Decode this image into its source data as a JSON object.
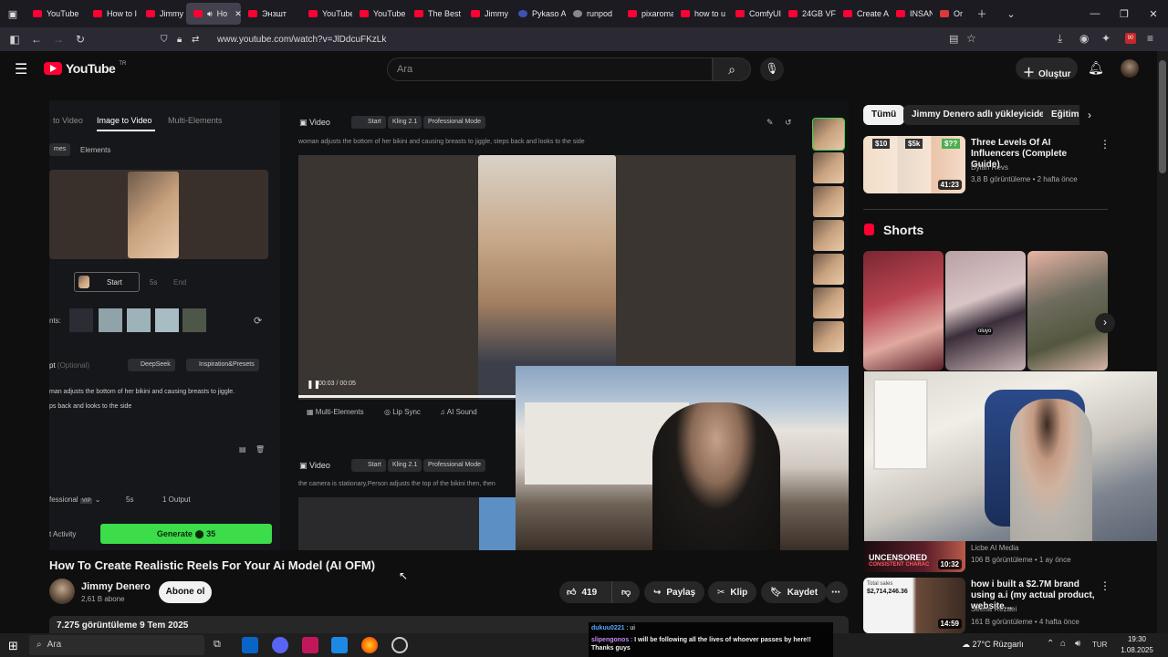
{
  "browser": {
    "tabs": [
      {
        "label": "YouTube",
        "icon": "youtube-icon"
      },
      {
        "label": "How to I",
        "icon": "youtube-icon"
      },
      {
        "label": "Jimmy D",
        "icon": "youtube-icon"
      },
      {
        "label": "Ho",
        "icon": "youtube-icon",
        "active": true
      },
      {
        "label": "Энзшт",
        "icon": "youtube-icon"
      },
      {
        "label": "YouTube",
        "icon": "youtube-icon"
      },
      {
        "label": "YouTube",
        "icon": "youtube-icon"
      },
      {
        "label": "The Best",
        "icon": "youtube-icon"
      },
      {
        "label": "Jimmy D",
        "icon": "youtube-icon"
      },
      {
        "label": "Pykaso A",
        "icon": "pykaso-icon"
      },
      {
        "label": "runpod",
        "icon": "runpod-icon"
      },
      {
        "label": "pixaroma",
        "icon": "youtube-icon"
      },
      {
        "label": "how to u",
        "icon": "youtube-icon"
      },
      {
        "label": "ComfyUI",
        "icon": "youtube-icon"
      },
      {
        "label": "24GB VF",
        "icon": "youtube-icon"
      },
      {
        "label": "Create A",
        "icon": "youtube-icon"
      },
      {
        "label": "INSANE",
        "icon": "youtube-icon"
      },
      {
        "label": "Or",
        "icon": "folder-icon"
      }
    ],
    "url": "www.youtube.com/watch?v=JlDdcuFKzLk",
    "extension_badge": "90"
  },
  "yt_header": {
    "logo": "YouTube",
    "logo_sup": "TR",
    "search_placeholder": "Ara",
    "create_label": "Oluştur"
  },
  "player": {
    "tabs": [
      "to Video",
      "Image to Video",
      "Multi-Elements"
    ],
    "subtabs": [
      "mes",
      "Elements"
    ],
    "start_label": "Start",
    "end_label": "End",
    "frame_sep": "5s",
    "elements_label": "nts:",
    "prompt_label": "pt",
    "prompt_optional": "(Optional)",
    "deepseek_label": "DeepSeek",
    "inspiration_label": "Inspiration&Presets",
    "prompt_text_1": "man adjusts the bottom of her bikini and causing breasts to jiggle.",
    "prompt_text_2": "ps back and looks to the side",
    "mode_label": "fessional",
    "vip_label": "VIP",
    "duration_label": "5s",
    "output_label": "1 Output",
    "activity_label": "t Activity",
    "generate_label": "Generate",
    "generate_cost": "35",
    "video1_label": "Video",
    "chip_start": "Start",
    "chip_kling": "Kling 2.1",
    "chip_pro": "Professional Mode",
    "video1_caption": "woman adjusts the bottom of her bikini and causing breasts to jiggle, steps back and looks to the side",
    "time_current": "00:03",
    "time_total": "00:05",
    "multi_elements": "Multi-Elements",
    "lip_sync": "Lip Sync",
    "ai_sound": "AI Sound",
    "video2_label": "Video",
    "video2_caption": "the camera is stationary,Person adjusts the top of the bikini then, then",
    "playback_progress": 0.6
  },
  "video_info": {
    "title": "How To Create Realistic Reels For Your Ai Model (AI OFM)",
    "channel": "Jimmy Denero",
    "subscribers": "2,61 B abone",
    "subscribe_label": "Abone ol",
    "likes": "419",
    "share_label": "Paylaş",
    "clip_label": "Klip",
    "save_label": "Kaydet",
    "views_date": "7.275 görüntüleme  9 Tem 2025"
  },
  "sidebar": {
    "chips": [
      "Tümü",
      "Jimmy Denero adlı yükleyiciden",
      "Eğitim"
    ],
    "videos": [
      {
        "title": "Three Levels Of AI Influencers (Complete Guide)",
        "channel": "Dylan Revs",
        "meta": "3,8 B görüntüleme • 2 hafta önce",
        "duration": "41:23",
        "thumb_text": [
          "$10",
          "$5k",
          "$??"
        ]
      },
      {
        "title": "",
        "channel": "Licbe AI Media",
        "meta": "106 B görüntüleme • 1 ay önce",
        "duration": "10:32",
        "thumb_text": [
          "UNCENSORED",
          "CONSISTENT CHARAC"
        ]
      },
      {
        "title": "how i built a $2.7M brand using a.i (my actual product, website...",
        "channel": "Seena Rezaei",
        "meta": "161 B görüntüleme • 4 hafta önce",
        "duration": "14:59",
        "thumb_text": [
          "Total sales",
          "$2,714,246.36"
        ]
      }
    ],
    "shorts_label": "Shorts",
    "shorts_sticker": "oluyo"
  },
  "chat": {
    "messages": [
      {
        "user": "dukuu0221",
        "text": "ui"
      },
      {
        "user": "slipengonos",
        "text": "I will be following all the lives of whoever passes by here!! Thanks guys"
      }
    ]
  },
  "taskbar": {
    "search_placeholder": "Ara",
    "weather": "27°C  Rüzgarlı",
    "language": "TUR",
    "time": "19:30",
    "date": "1.08.2025"
  },
  "colors": {
    "background": "#0f0f0f",
    "youtube_red": "#ff0033",
    "generate_green": "#3ddc4a",
    "chip_active": "#f1f1f1"
  }
}
